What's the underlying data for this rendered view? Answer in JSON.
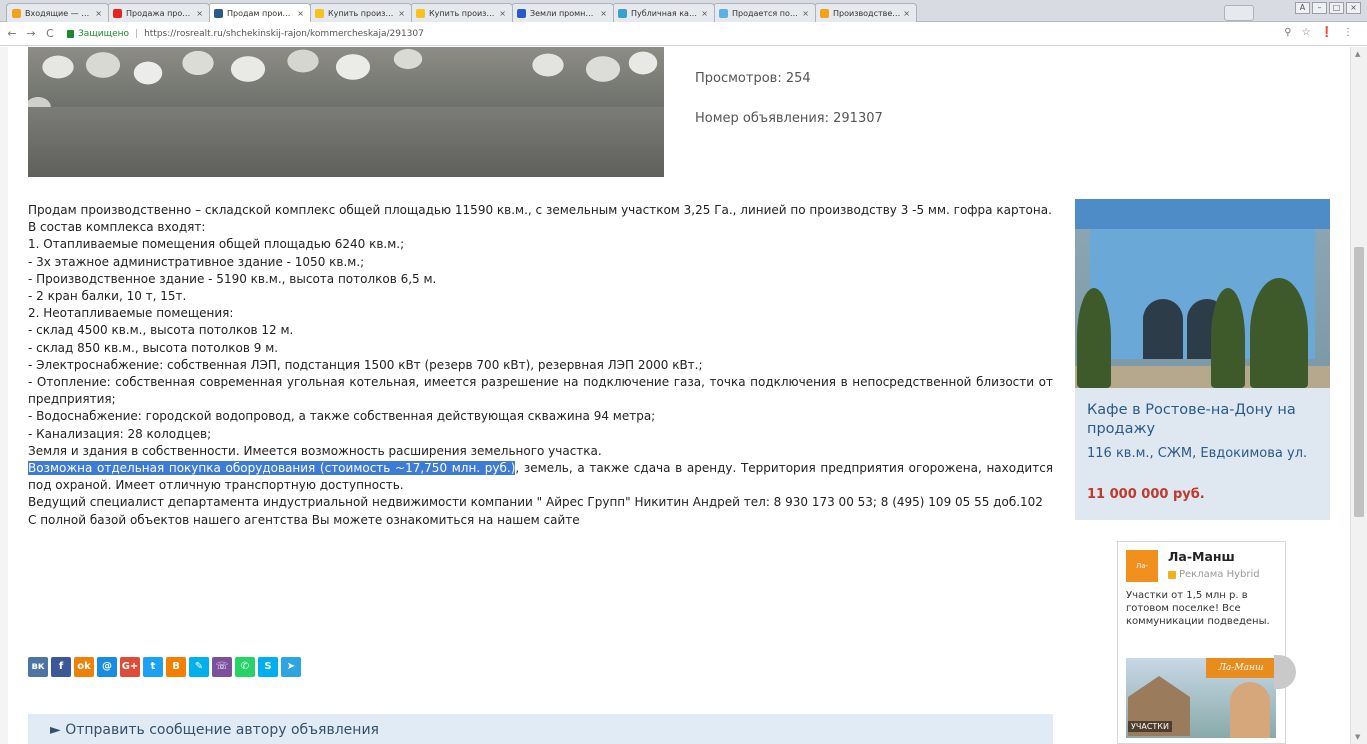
{
  "browser": {
    "tabs": [
      {
        "title": "Входящие — Яндекс.П",
        "color": "#f2a31b",
        "active": false
      },
      {
        "title": "Продажа производстве",
        "color": "#e52620",
        "active": false
      },
      {
        "title": "Продам производстве",
        "color": "#2a5a8a",
        "active": true
      },
      {
        "title": "Купить производствен",
        "color": "#f6c21b",
        "active": false
      },
      {
        "title": "Купить производствен",
        "color": "#f6c21b",
        "active": false
      },
      {
        "title": "Земли промназначени",
        "color": "#2a5ac8",
        "active": false
      },
      {
        "title": "Публичная кадастрова",
        "color": "#3aa0d0",
        "active": false
      },
      {
        "title": "Продается помещение",
        "color": "#5ab0e8",
        "active": false
      },
      {
        "title": "Производственное по",
        "color": "#f2a31b",
        "active": false
      }
    ],
    "secure_label": "Защищено",
    "url": "https://rosrealt.ru/shchekinskij-rajon/kommercheskaja/291307"
  },
  "listing": {
    "views": "Просмотров: 254",
    "ad_number": "Номер объявления: 291307",
    "description": [
      "Продам производственно – складской комплекс общей площадью 11590 кв.м., с земельным участком 3,25 Га., линией по производству 3 -5 мм. гофра картона.",
      "В состав комплекса входят:",
      "1. Отапливаемые помещения общей площадью 6240 кв.м.;",
      "- 3х этажное административное здание - 1050 кв.м.;",
      "- Производственное здание - 5190 кв.м., высота потолков 6,5 м.",
      "- 2 кран балки, 10 т, 15т.",
      "2. Неотапливаемые помещения:",
      "- склад 4500 кв.м., высота потолков 12 м.",
      "- склад 850 кв.м., высота потолков 9 м.",
      "- Электроснабжение: собственная ЛЭП, подстанция 1500 кВт (резерв 700 кВт), резервная ЛЭП 2000 кВт.;",
      "- Отопление: собственная современная угольная котельная, имеется разрешение на подключение газа, точка подключения в непосредственной близости от предприятия;",
      "- Водоснабжение: городской водопровод, а также собственная действующая скважина 94 метра;",
      "- Канализация: 28 колодцев;",
      "Земля и здания в собственности. Имеется возможность расширения земельного участка."
    ],
    "highlighted": "Возможна отдельная покупка оборудования (стоимость ~17,750 млн. руб.)",
    "after_highlight": ", земель, а также сдача в аренду. Территория предприятия огорожена, находится под охраной. Имеет отличную транспортную доступность.",
    "contact": "Ведущий специалист департамента индустриальной недвижимости компании \" Айрес Групп\" Никитин Андрей тел: 8 930 173 00 53; 8 (495) 109 05 55 доб.102",
    "agency": "С полной базой объектов нашего агентства Вы можете ознакомиться на нашем сайте",
    "send_message": "► Отправить сообщение автору объявления"
  },
  "share_buttons": [
    {
      "name": "vk-icon",
      "glyph": "вк",
      "color": "#4c75a3"
    },
    {
      "name": "facebook-icon",
      "glyph": "f",
      "color": "#3b5998"
    },
    {
      "name": "odnoklassniki-icon",
      "glyph": "ok",
      "color": "#ee8208"
    },
    {
      "name": "moimir-icon",
      "glyph": "@",
      "color": "#168de2"
    },
    {
      "name": "googleplus-icon",
      "glyph": "G+",
      "color": "#dd4b39"
    },
    {
      "name": "twitter-icon",
      "glyph": "t",
      "color": "#1da1f2"
    },
    {
      "name": "blogger-icon",
      "glyph": "B",
      "color": "#f57d00"
    },
    {
      "name": "livejournal-icon",
      "glyph": "✎",
      "color": "#00b0ea"
    },
    {
      "name": "viber-icon",
      "glyph": "☏",
      "color": "#7b519d"
    },
    {
      "name": "whatsapp-icon",
      "glyph": "✆",
      "color": "#25d366"
    },
    {
      "name": "skype-icon",
      "glyph": "S",
      "color": "#00aff0"
    },
    {
      "name": "telegram-icon",
      "glyph": "➤",
      "color": "#2ca5e0"
    }
  ],
  "side_ad": {
    "title": "Кафе в Ростове-на-Дону на продажу",
    "subtitle": "116 кв.м., СЖМ, Евдокимова ул.",
    "price": "11 000 000 руб."
  },
  "hybrid_ad": {
    "logo_text": "Ла-Манш",
    "name": "Ла-Манш",
    "label": "Реклама Hybrid",
    "text": "Участки от 1,5 млн р. в готовом поселке! Все коммуникации подведены.",
    "brand": "Ла-Манш",
    "caption": "УЧАСТКИ"
  }
}
